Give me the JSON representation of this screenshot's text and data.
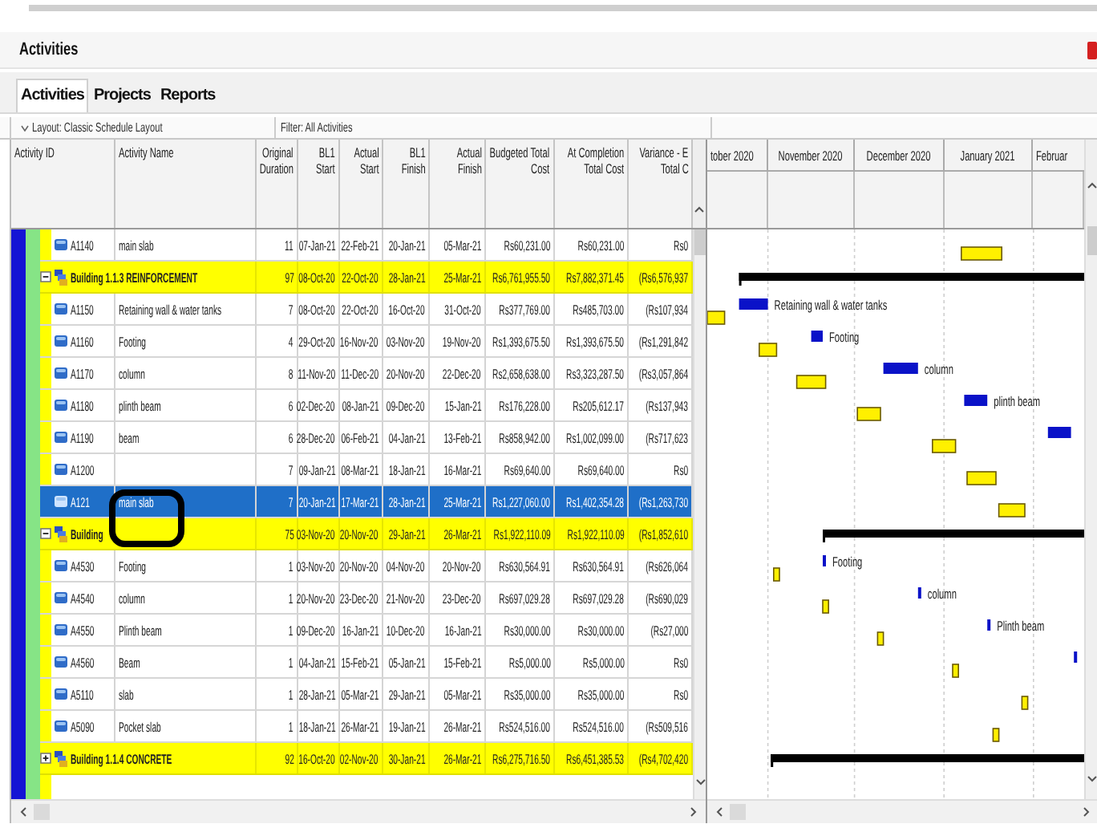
{
  "window": {
    "title": "Activities"
  },
  "tabs": [
    {
      "label": "Activities",
      "selected": true
    },
    {
      "label": "Projects",
      "selected": false
    },
    {
      "label": "Reports",
      "selected": false
    }
  ],
  "toolbar": {
    "layout": "Layout: Classic Schedule Layout",
    "filter": "Filter: All Activities"
  },
  "columns": [
    {
      "label": "Activity ID"
    },
    {
      "label": "Activity Name"
    },
    {
      "label": "Original Duration"
    },
    {
      "label": "BL1 Start"
    },
    {
      "label": "Actual Start"
    },
    {
      "label": "BL1 Finish"
    },
    {
      "label": "Actual Finish"
    },
    {
      "label": "Budgeted Total Cost"
    },
    {
      "label": "At Completion Total Cost"
    },
    {
      "label": "Variance - E",
      "second_line": "Total C"
    }
  ],
  "gantt": {
    "months": [
      {
        "label": "tober 2020"
      },
      {
        "label": "November 2020"
      },
      {
        "label": "December 2020"
      },
      {
        "label": "January 2021"
      },
      {
        "label": "Februar"
      }
    ]
  },
  "rows": [
    {
      "kind": "activity",
      "id": "A1140",
      "name": "main slab",
      "original_duration": "11",
      "bl1_start": "07-Jan-21",
      "actual_start": "22-Feb-21",
      "bl1_finish": "20-Jan-21",
      "actual_finish": "05-Mar-21",
      "budgeted_total_cost": "Rs60,231.00",
      "at_completion_total_cost": "Rs60,231.00",
      "variance": "Rs0",
      "selected": false
    },
    {
      "kind": "wbs",
      "name": "Building 1.1.3 REINFORCEMENT",
      "expanded": true,
      "selected": false,
      "original_duration": "97",
      "bl1_start": "08-Oct-20",
      "actual_start": "22-Oct-20",
      "bl1_finish": "28-Jan-21",
      "actual_finish": "25-Mar-21",
      "budgeted_total_cost": "Rs6,761,955.50",
      "at_completion_total_cost": "Rs7,882,371.45",
      "variance": "(Rs6,576,937",
      "children": [
        {
          "kind": "activity",
          "id": "A1150",
          "name": "Retaining wall & water tanks",
          "original_duration": "7",
          "bl1_start": "08-Oct-20",
          "actual_start": "22-Oct-20",
          "bl1_finish": "16-Oct-20",
          "actual_finish": "31-Oct-20",
          "budgeted_total_cost": "Rs377,769.00",
          "at_completion_total_cost": "Rs485,703.00",
          "variance": "(Rs107,934",
          "selected": false,
          "bar_label": "Retaining wall & water tanks"
        },
        {
          "kind": "activity",
          "id": "A1160",
          "name": "Footing",
          "original_duration": "4",
          "bl1_start": "29-Oct-20",
          "actual_start": "16-Nov-20",
          "bl1_finish": "03-Nov-20",
          "actual_finish": "19-Nov-20",
          "budgeted_total_cost": "Rs1,393,675.50",
          "at_completion_total_cost": "Rs1,393,675.50",
          "variance": "(Rs1,291,842",
          "selected": false,
          "bar_label": "Footing"
        },
        {
          "kind": "activity",
          "id": "A1170",
          "name": "column",
          "original_duration": "8",
          "bl1_start": "11-Nov-20",
          "actual_start": "11-Dec-20",
          "bl1_finish": "20-Nov-20",
          "actual_finish": "22-Dec-20",
          "budgeted_total_cost": "Rs2,658,638.00",
          "at_completion_total_cost": "Rs3,323,287.50",
          "variance": "(Rs3,057,864",
          "selected": false,
          "bar_label": "column"
        },
        {
          "kind": "activity",
          "id": "A1180",
          "name": "plinth beam",
          "original_duration": "6",
          "bl1_start": "02-Dec-20",
          "actual_start": "08-Jan-21",
          "bl1_finish": "09-Dec-20",
          "actual_finish": "15-Jan-21",
          "budgeted_total_cost": "Rs176,228.00",
          "at_completion_total_cost": "Rs205,612.17",
          "variance": "(Rs137,943",
          "selected": false,
          "bar_label": "plinth beam"
        },
        {
          "kind": "activity",
          "id": "A1190",
          "name": "beam",
          "original_duration": "6",
          "bl1_start": "28-Dec-20",
          "actual_start": "06-Feb-21",
          "bl1_finish": "04-Jan-21",
          "actual_finish": "13-Feb-21",
          "budgeted_total_cost": "Rs858,942.00",
          "at_completion_total_cost": "Rs1,002,099.00",
          "variance": "(Rs717,623",
          "selected": false
        },
        {
          "kind": "activity",
          "id": "A1200",
          "original_duration": "7",
          "bl1_start": "09-Jan-21",
          "actual_start": "08-Mar-21",
          "bl1_finish": "18-Jan-21",
          "actual_finish": "16-Mar-21",
          "budgeted_total_cost": "Rs69,640.00",
          "at_completion_total_cost": "Rs69,640.00",
          "variance": "Rs0",
          "selected": false
        },
        {
          "kind": "activity",
          "id": "A121",
          "name": "main slab",
          "original_duration": "7",
          "bl1_start": "20-Jan-21",
          "actual_start": "17-Mar-21",
          "bl1_finish": "28-Jan-21",
          "actual_finish": "25-Mar-21",
          "budgeted_total_cost": "Rs1,227,060.00",
          "at_completion_total_cost": "Rs1,402,354.28",
          "variance": "(Rs1,263,730",
          "selected": true
        }
      ]
    },
    {
      "kind": "wbs",
      "name": "Building",
      "expanded": true,
      "selected": false,
      "original_duration": "75",
      "bl1_start": "03-Nov-20",
      "actual_start": "20-Nov-20",
      "bl1_finish": "29-Jan-21",
      "actual_finish": "26-Mar-21",
      "budgeted_total_cost": "Rs1,922,110.09",
      "at_completion_total_cost": "Rs1,922,110.09",
      "variance": "(Rs1,852,610",
      "children": [
        {
          "kind": "activity",
          "id": "A4530",
          "name": "Footing",
          "original_duration": "1",
          "bl1_start": "03-Nov-20",
          "actual_start": "20-Nov-20",
          "bl1_finish": "04-Nov-20",
          "actual_finish": "20-Nov-20",
          "budgeted_total_cost": "Rs630,564.91",
          "at_completion_total_cost": "Rs630,564.91",
          "variance": "(Rs626,064",
          "selected": false,
          "bar_label": "Footing"
        },
        {
          "kind": "activity",
          "id": "A4540",
          "name": "column",
          "original_duration": "1",
          "bl1_start": "20-Nov-20",
          "actual_start": "23-Dec-20",
          "bl1_finish": "21-Nov-20",
          "actual_finish": "23-Dec-20",
          "budgeted_total_cost": "Rs697,029.28",
          "at_completion_total_cost": "Rs697,029.28",
          "variance": "(Rs690,029",
          "selected": false,
          "bar_label": "column"
        },
        {
          "kind": "activity",
          "id": "A4550",
          "name": "Plinth beam",
          "original_duration": "1",
          "bl1_start": "09-Dec-20",
          "actual_start": "16-Jan-21",
          "bl1_finish": "10-Dec-20",
          "actual_finish": "16-Jan-21",
          "budgeted_total_cost": "Rs30,000.00",
          "at_completion_total_cost": "Rs30,000.00",
          "variance": "(Rs27,000",
          "selected": false,
          "bar_label": "Plinth beam"
        },
        {
          "kind": "activity",
          "id": "A4560",
          "name": "Beam",
          "original_duration": "1",
          "bl1_start": "04-Jan-21",
          "actual_start": "15-Feb-21",
          "bl1_finish": "05-Jan-21",
          "actual_finish": "15-Feb-21",
          "budgeted_total_cost": "Rs5,000.00",
          "at_completion_total_cost": "Rs5,000.00",
          "variance": "Rs0",
          "selected": false
        },
        {
          "kind": "activity",
          "id": "A5110",
          "name": "slab",
          "original_duration": "1",
          "bl1_start": "28-Jan-21",
          "actual_start": "05-Mar-21",
          "bl1_finish": "29-Jan-21",
          "actual_finish": "05-Mar-21",
          "budgeted_total_cost": "Rs35,000.00",
          "at_completion_total_cost": "Rs35,000.00",
          "variance": "Rs0",
          "selected": false
        },
        {
          "kind": "activity",
          "id": "A5090",
          "name": "Pocket slab",
          "original_duration": "1",
          "bl1_start": "18-Jan-21",
          "actual_start": "26-Mar-21",
          "bl1_finish": "19-Jan-21",
          "actual_finish": "26-Mar-21",
          "budgeted_total_cost": "Rs524,516.00",
          "at_completion_total_cost": "Rs524,516.00",
          "variance": "(Rs509,516",
          "selected": false
        }
      ]
    },
    {
      "kind": "wbs",
      "name": "Building 1.1.4 CONCRETE",
      "expanded": false,
      "selected": false,
      "original_duration": "92",
      "bl1_start": "16-Oct-20",
      "actual_start": "02-Nov-20",
      "bl1_finish": "30-Jan-21",
      "actual_finish": "26-Mar-21",
      "budgeted_total_cost": "Rs6,275,716.50",
      "at_completion_total_cost": "Rs6,451,385.53",
      "variance": "(Rs4,702,420"
    }
  ]
}
